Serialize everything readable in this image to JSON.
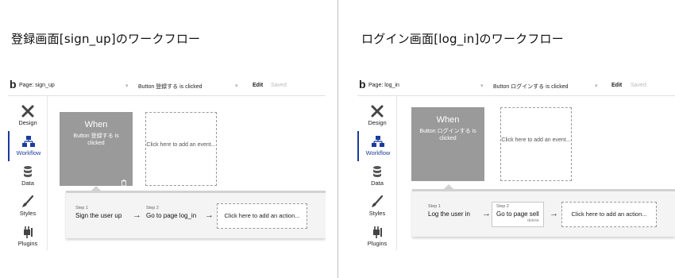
{
  "headings": {
    "left": "登録画面[sign_up]のワークフロー",
    "right": "ログイン画面[log_in]のワークフロー"
  },
  "icons": {
    "logo": "bubble-b-logo",
    "design": "crossed-tools-icon",
    "workflow": "sitemap-icon",
    "data": "database-icon",
    "styles": "brush-icon",
    "plugins": "plug-icon",
    "trash": "trash-icon",
    "arrow": "→"
  },
  "colors": {
    "accent": "#1b3b9e",
    "when_box": "#9a9a9a"
  },
  "sidebar_labels": [
    "Design",
    "Workflow",
    "Data",
    "Styles",
    "Plugins"
  ],
  "panels": {
    "signup": {
      "logo_glyph": "b",
      "page_label": "Page: sign_up",
      "page_caret": "▾",
      "event_select": "Button 登録する is clicked",
      "event_caret": "▾",
      "edit": "Edit",
      "saved": "Saved",
      "when_title": "When",
      "when_sub": "Button 登録する is clicked",
      "add_event": "Click here to add an event...",
      "steps": [
        {
          "num": "Step 1",
          "title": "Sign the user up"
        },
        {
          "num": "Step 2",
          "title": "Go to page log_in"
        }
      ],
      "add_action": "Click here to add an action..."
    },
    "login": {
      "logo_glyph": "b",
      "page_label": "Page: log_in",
      "page_caret": "▾",
      "event_select": "Button ログインする is clicked",
      "event_caret": "▾",
      "edit": "Edit",
      "saved": "Saved",
      "when_title": "When",
      "when_sub": "Button ログインする is clicked",
      "add_event": "Click here to add an event...",
      "steps": [
        {
          "num": "Step 1",
          "title": "Log the user in"
        },
        {
          "num": "Step 2",
          "title": "Go to page sell",
          "delete": "delete"
        }
      ],
      "add_action": "Click here to add an action..."
    }
  }
}
